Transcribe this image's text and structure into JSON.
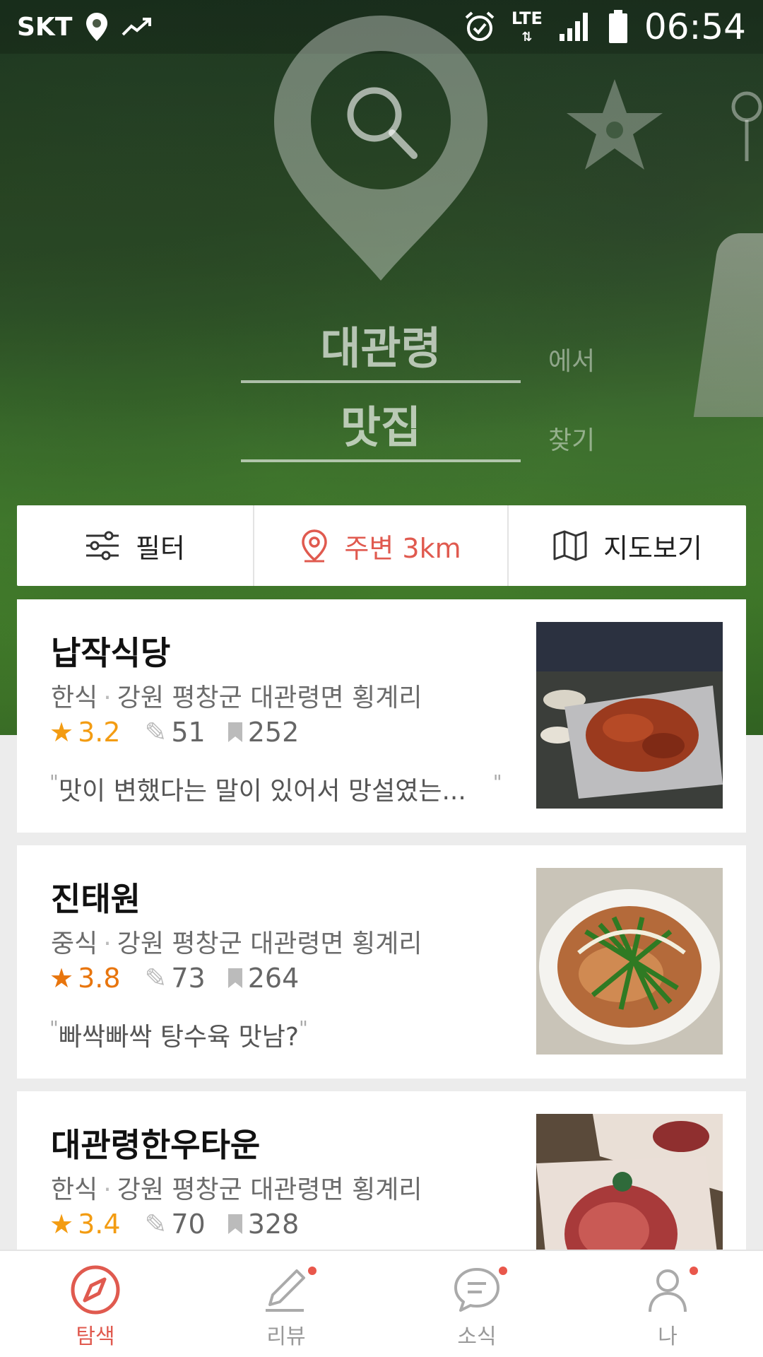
{
  "status_bar": {
    "carrier": "SKT",
    "network": "LTE",
    "time": "06:54"
  },
  "search": {
    "location": "대관령",
    "location_suffix": "에서",
    "keyword": "맛집",
    "keyword_suffix": "찾기"
  },
  "filter_bar": {
    "filter_label": "필터",
    "nearby_label": "주변 3km",
    "map_label": "지도보기"
  },
  "restaurants": [
    {
      "name": "납작식당",
      "category": "한식",
      "address": "강원 평창군 대관령면 횡계리",
      "rating": "3.2",
      "reviews": "51",
      "bookmarks": "252",
      "quote": "맛이 변했다는 말이 있어서 망설였는..."
    },
    {
      "name": "진태원",
      "category": "중식",
      "address": "강원 평창군 대관령면 횡계리",
      "rating": "3.8",
      "reviews": "73",
      "bookmarks": "264",
      "quote": "빠싹빠싹 탕수육 맛남?"
    },
    {
      "name": "대관령한우타운",
      "category": "한식",
      "address": "강원 평창군 대관령면 횡계리",
      "rating": "3.4",
      "reviews": "70",
      "bookmarks": "328"
    }
  ],
  "bottom_nav": [
    {
      "label": "탐색",
      "icon": "compass-icon",
      "active": true
    },
    {
      "label": "리뷰",
      "icon": "pencil-icon",
      "badge": true
    },
    {
      "label": "소식",
      "icon": "chat-bubble-icon",
      "badge": true
    },
    {
      "label": "나",
      "icon": "person-icon",
      "badge": true
    }
  ],
  "colors": {
    "accent": "#e05a4f",
    "rating": "#f39c12"
  }
}
